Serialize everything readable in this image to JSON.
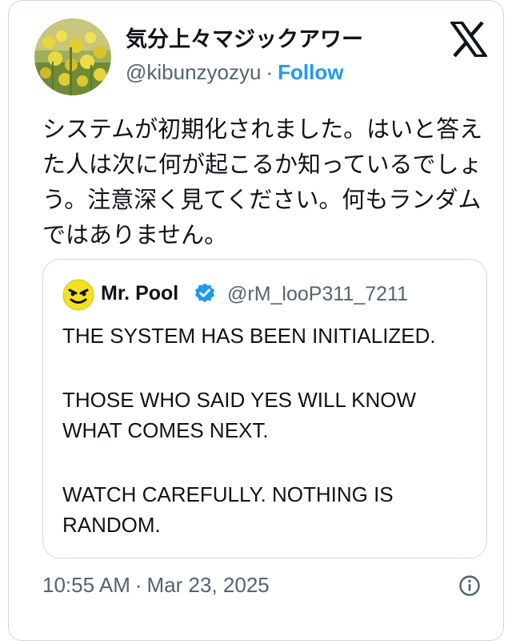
{
  "tweet": {
    "display_name": "気分上々マジックアワー",
    "handle": "@kibunzyozyu",
    "separator": "·",
    "follow_label": "Follow",
    "text": "システムが初期化されました。はいと答えた人は次に何が起こるか知っているでしょう。注意深く見てください。何もランダムではありません。",
    "time": "10:55 AM",
    "date": "Mar 23, 2025",
    "avatar_icon": "yellow-flowers-photo",
    "logo_icon": "x-logo-icon",
    "info_icon": "info-icon"
  },
  "quote": {
    "name": "Mr. Pool",
    "verified_icon": "verified-badge-icon",
    "handle": "@rM_looP311_7211",
    "paragraphs": [
      "THE SYSTEM HAS BEEN INITIALIZED.",
      "THOSE WHO SAID YES WILL KNOW WHAT COMES NEXT.",
      "WATCH CAREFULLY. NOTHING IS RANDOM."
    ],
    "avatar_icon": "smiley-face-icon"
  },
  "colors": {
    "accent": "#1d9bf0",
    "text": "#0f1419",
    "secondary": "#536471",
    "border": "#cfd9de"
  }
}
